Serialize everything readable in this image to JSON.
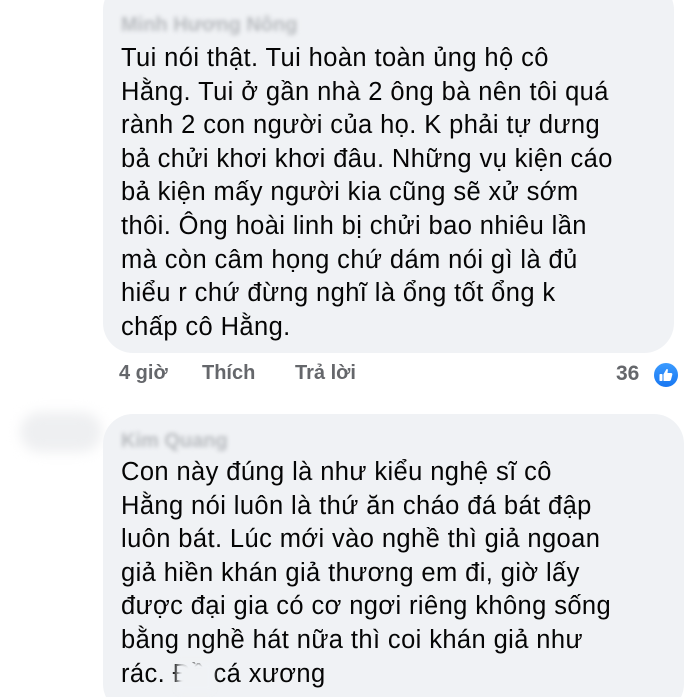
{
  "comments": [
    {
      "author": "Minh Hương Nông",
      "text": "Tui nói thật. Tui hoàn toàn ủng hộ cô\nHằng. Tui ở gần nhà 2 ông bà nên tôi quá\nrành 2 con người của họ. K phải tự dưng\nbả chửi khơi khơi đâu. Những vụ kiện cáo\nbả kiện mấy người kia cũng sẽ xử sớm\nthôi. Ông hoài linh bị chửi bao nhiêu lần\nmà còn câm họng chứ dám nói gì là đủ\nhiểu r chứ đừng nghĩ là ổng tốt ổng k\nchấp cô Hằng.",
      "time": "4 giờ",
      "like_label": "Thích",
      "reply_label": "Trả lời",
      "reaction_count": "36",
      "reaction_icon": "thumbs-up-icon",
      "reaction_color": "#1877f2"
    },
    {
      "author": "Kim Quang",
      "text": "Con này đúng là như kiểu nghệ sĩ cô\nHằng nói luôn là thứ ăn cháo đá bát đập\nluôn bát. Lúc mới vào nghề thì giả ngoan\ngiả hiền khán giả thương em đi, giờ lấy\nđược đại gia có cơ ngơi riêng không sống\nbằng nghề hát nữa thì coi khán giả như\nrác. Đồ cá xương"
    }
  ],
  "colors": {
    "bubble_bg": "#f0f2f5",
    "text": "#050505",
    "meta_text": "#65676b",
    "like_blue": "#1877f2"
  }
}
